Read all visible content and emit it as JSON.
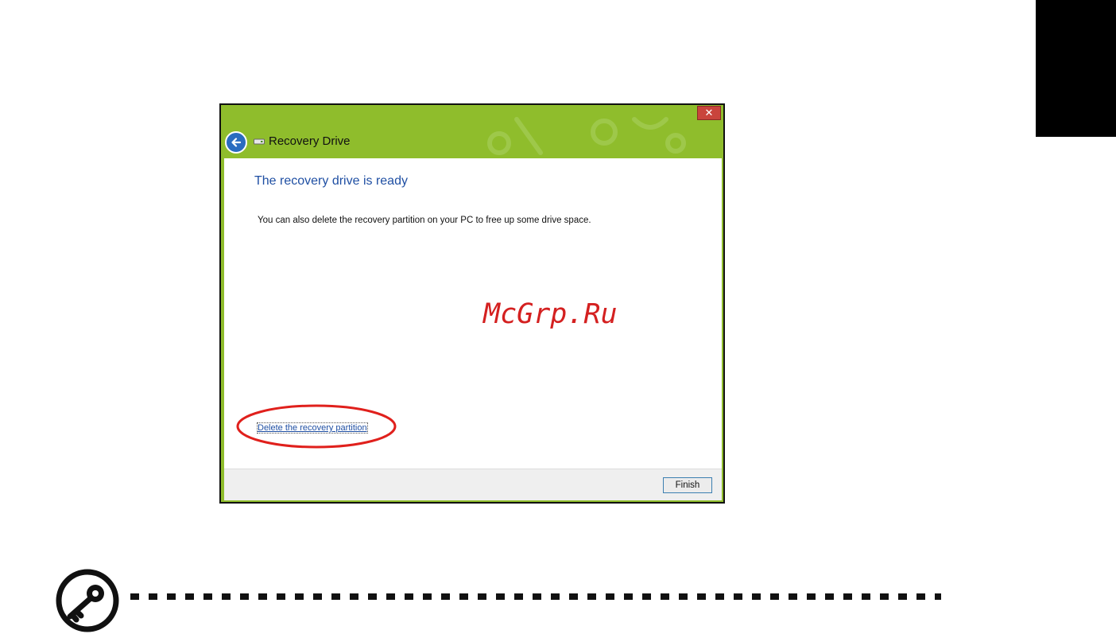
{
  "window": {
    "title": "Recovery Drive",
    "close_glyph": "✕",
    "heading": "The recovery drive is ready",
    "message": "You can also delete the recovery partition on your PC to free up some drive space.",
    "delete_link": "Delete the recovery partition",
    "finish_button": "Finish",
    "accent_color": "#8fbd2c",
    "heading_color": "#1f4fa3"
  },
  "watermark": {
    "text": "McGrp.Ru",
    "color": "#d42020"
  },
  "annotation": {
    "ellipse_color": "#e0201c"
  },
  "icons": {
    "back": "back-arrow-icon",
    "drive": "drive-icon",
    "close": "close-icon",
    "note": "key-note-icon"
  }
}
